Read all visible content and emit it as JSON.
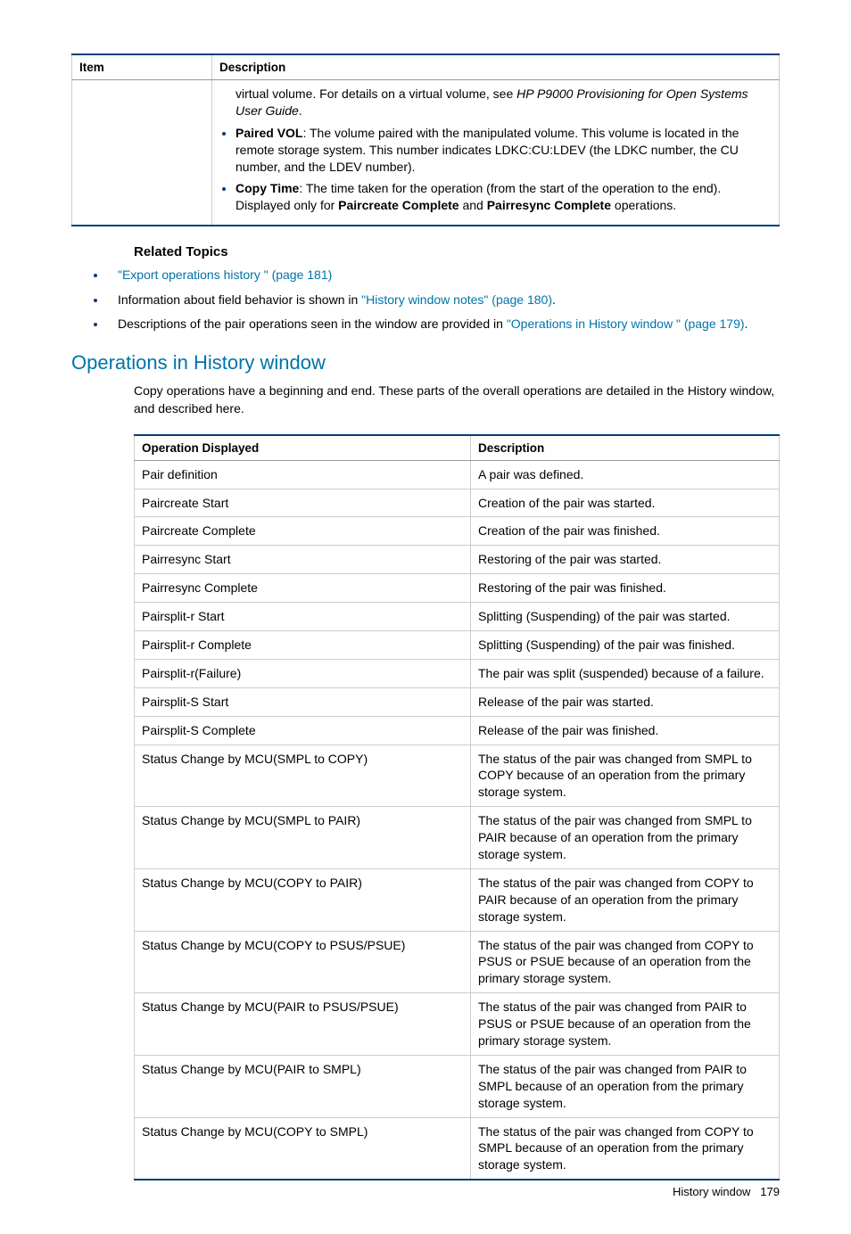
{
  "table1": {
    "headers": [
      "Item",
      "Description"
    ],
    "continuation_pre": "virtual volume. For details on a virtual volume, see ",
    "continuation_italic": "HP P9000 Provisioning for Open Systems User Guide",
    "continuation_post": ".",
    "bullet1_bold": "Paired VOL",
    "bullet1_rest": ": The volume paired with the manipulated volume. This volume is located in the remote storage system. This number indicates LDKC:CU:LDEV (the LDKC number, the CU number, and the LDEV number).",
    "bullet2_bold": "Copy Time",
    "bullet2_mid": ": The time taken for the operation (from the start of the operation to the end). Displayed only for ",
    "bullet2_b2": "Paircreate Complete",
    "bullet2_and": " and ",
    "bullet2_b3": "Pairresync Complete",
    "bullet2_end": " operations."
  },
  "related": {
    "heading": "Related Topics",
    "item1_link": "\"Export operations history \" (page 181)",
    "item2_pre": "Information about field behavior is shown in ",
    "item2_link": "\"History window notes\" (page 180)",
    "item2_post": ".",
    "item3_pre": "Descriptions of the pair operations seen in the window are provided in ",
    "item3_link": "\"Operations in History window \" (page 179)",
    "item3_post": "."
  },
  "section": {
    "heading": "Operations in History window",
    "intro": "Copy operations have a beginning and end. These parts of the overall operations are detailed in the History window, and described here."
  },
  "table2": {
    "headers": [
      "Operation Displayed",
      "Description"
    ],
    "rows": [
      {
        "op": "Pair definition",
        "desc": "A pair was defined."
      },
      {
        "op": "Paircreate Start",
        "desc": "Creation of the pair was started."
      },
      {
        "op": "Paircreate Complete",
        "desc": "Creation of the pair was finished."
      },
      {
        "op": "Pairresync Start",
        "desc": "Restoring of the pair was started."
      },
      {
        "op": "Pairresync Complete",
        "desc": "Restoring of the pair was finished."
      },
      {
        "op": "Pairsplit-r Start",
        "desc": "Splitting (Suspending) of the pair was started."
      },
      {
        "op": "Pairsplit-r Complete",
        "desc": "Splitting (Suspending) of the pair was finished."
      },
      {
        "op": "Pairsplit-r(Failure)",
        "desc": "The pair was split (suspended) because of a failure."
      },
      {
        "op": "Pairsplit-S Start",
        "desc": "Release of the pair was started."
      },
      {
        "op": "Pairsplit-S Complete",
        "desc": "Release of the pair was finished."
      },
      {
        "op": "Status Change by MCU(SMPL to COPY)",
        "desc": "The status of the pair was changed from SMPL to COPY because of an operation from the primary storage system."
      },
      {
        "op": "Status Change by MCU(SMPL to PAIR)",
        "desc": "The status of the pair was changed from SMPL to PAIR because of an operation from the primary storage system."
      },
      {
        "op": "Status Change by MCU(COPY to PAIR)",
        "desc": "The status of the pair was changed from COPY to PAIR because of an operation from the primary storage system."
      },
      {
        "op": "Status Change by MCU(COPY to PSUS/PSUE)",
        "desc": "The status of the pair was changed from COPY to PSUS or PSUE because of an operation from the primary storage system."
      },
      {
        "op": "Status Change by MCU(PAIR to PSUS/PSUE)",
        "desc": "The status of the pair was changed from PAIR to PSUS or PSUE because of an operation from the primary storage system."
      },
      {
        "op": "Status Change by MCU(PAIR to SMPL)",
        "desc": "The status of the pair was changed from PAIR to SMPL because of an operation from the primary storage system."
      },
      {
        "op": "Status Change by MCU(COPY to SMPL)",
        "desc": "The status of the pair was changed from COPY to SMPL because of an operation from the primary storage system."
      }
    ]
  },
  "footer": {
    "label": "History window",
    "page": "179"
  }
}
